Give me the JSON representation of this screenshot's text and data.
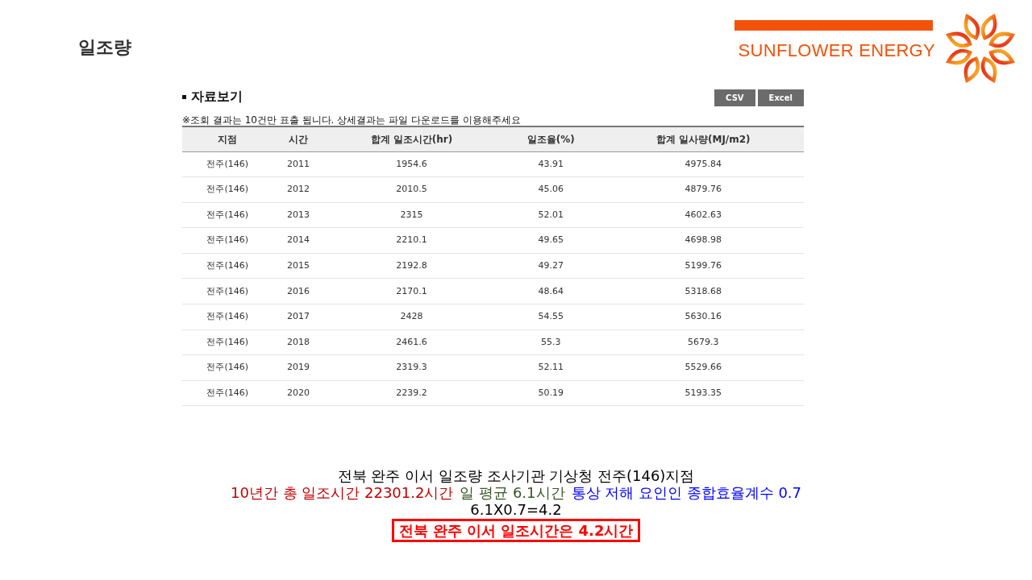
{
  "slide_title": "일조량",
  "brand": {
    "name": "SUNFLOWER ENERGY"
  },
  "data_view": {
    "title": "자료보기",
    "buttons": [
      "CSV",
      "Excel"
    ],
    "notice": "※조회 결과는 10건만 표출 됩니다. 상세결과는 파일 다운로드를 이용해주세요",
    "table": {
      "columns": [
        "지점",
        "시간",
        "합계 일조시간(hr)",
        "일조율(%)",
        "합계 일사량(MJ/m2)"
      ],
      "rows": [
        [
          "전주(146)",
          "2011",
          "1954.6",
          "43.91",
          "4975.84"
        ],
        [
          "전주(146)",
          "2012",
          "2010.5",
          "45.06",
          "4879.76"
        ],
        [
          "전주(146)",
          "2013",
          "2315",
          "52.01",
          "4602.63"
        ],
        [
          "전주(146)",
          "2014",
          "2210.1",
          "49.65",
          "4698.98"
        ],
        [
          "전주(146)",
          "2015",
          "2192.8",
          "49.27",
          "5199.76"
        ],
        [
          "전주(146)",
          "2016",
          "2170.1",
          "48.64",
          "5318.68"
        ],
        [
          "전주(146)",
          "2017",
          "2428",
          "54.55",
          "5630.16"
        ],
        [
          "전주(146)",
          "2018",
          "2461.6",
          "55.3",
          "5679.3"
        ],
        [
          "전주(146)",
          "2019",
          "2319.3",
          "52.11",
          "5529.66"
        ],
        [
          "전주(146)",
          "2020",
          "2239.2",
          "50.19",
          "5193.35"
        ]
      ]
    }
  },
  "summary": {
    "lines": [
      [
        {
          "text": "전북 완주 이서 일조량 조사기관 기상청 전주(146)지점",
          "color": "#000000"
        }
      ],
      [
        {
          "text": "10년간 총 일조시간 22301.2시간",
          "color": "#c00000"
        },
        {
          "text": "일 평균 6.1시간",
          "color": "#375623"
        },
        {
          "text": "통상 저해 요인인 종합효율계수 0.7",
          "color": "#0000ff"
        }
      ],
      [
        {
          "text": "6.1X0.7=4.2",
          "color": "#000000"
        }
      ]
    ],
    "conclusion": "전북 완주 이서 일조시간은 4.2시간"
  }
}
